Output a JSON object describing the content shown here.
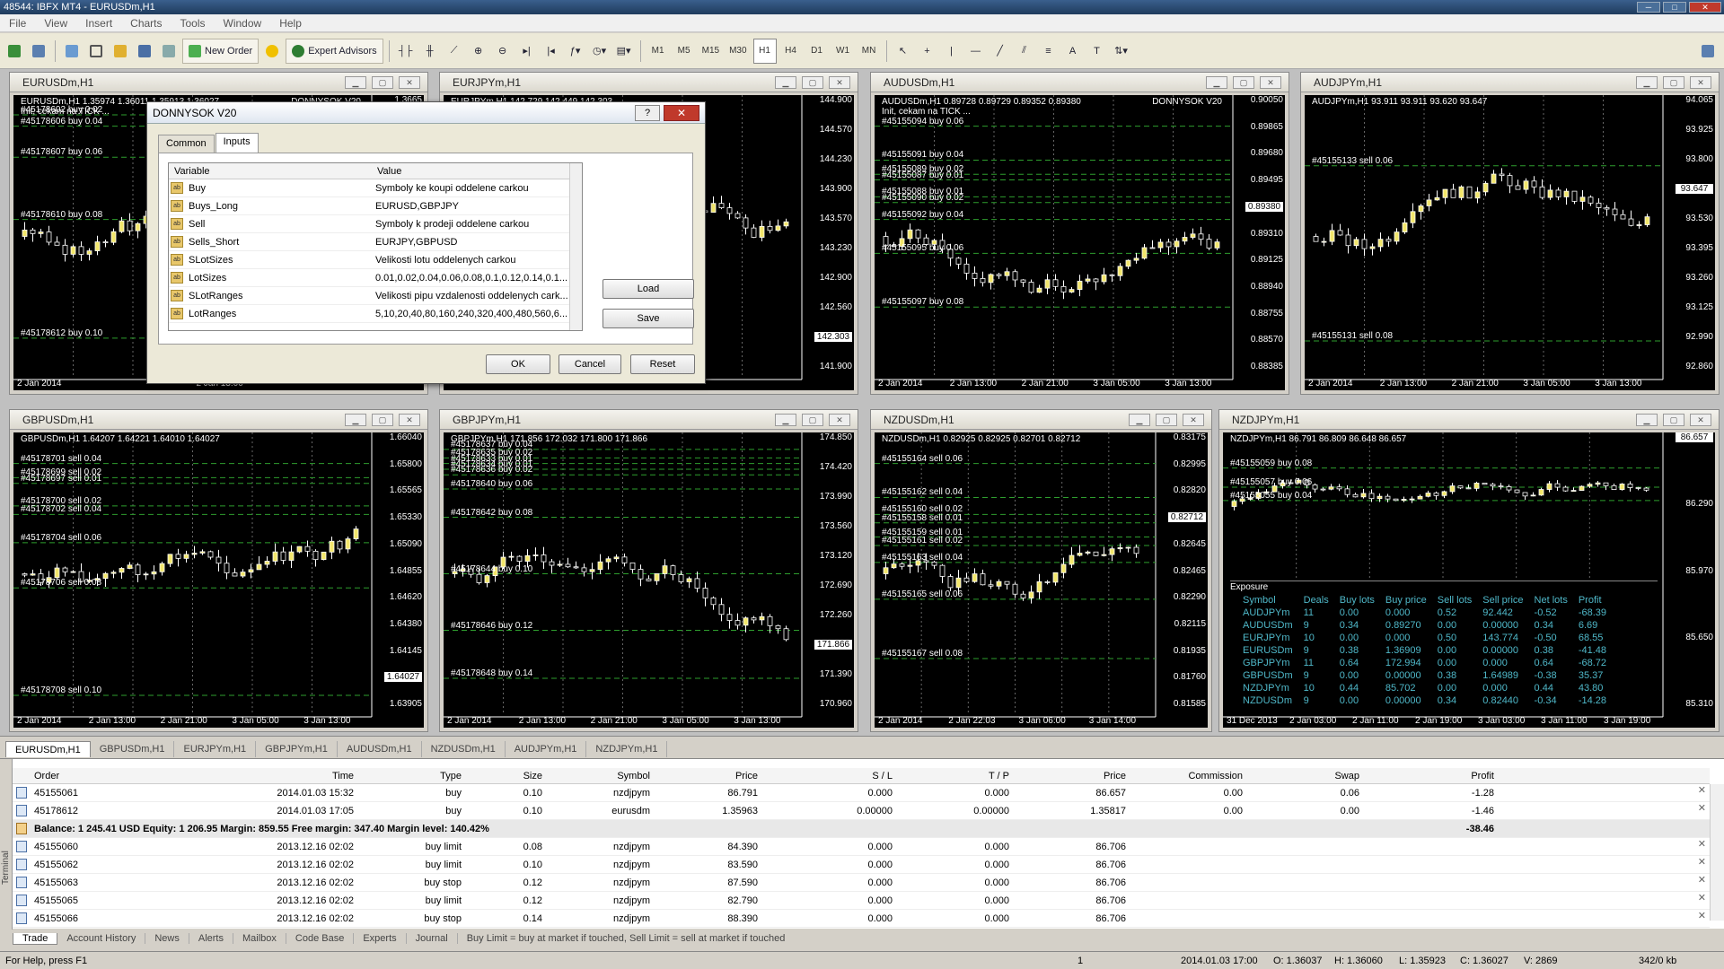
{
  "window": {
    "title": "48544: IBFX MT4 - EURUSDm,H1",
    "min": "─",
    "max": "□",
    "close": "✕"
  },
  "menu": [
    "File",
    "View",
    "Insert",
    "Charts",
    "Tools",
    "Window",
    "Help"
  ],
  "toolbar": {
    "new_order": "New Order",
    "expert_advisors": "Expert Advisors",
    "timeframes": [
      "M1",
      "M5",
      "M15",
      "M30",
      "H1",
      "H4",
      "D1",
      "W1",
      "MN"
    ]
  },
  "charts": [
    {
      "title": "EURUSDm,H1",
      "header": "EURUSDm,H1  1.35974 1.36011 1.35913 1.36027",
      "sub": "Init, cekam na TICK ...",
      "ea": "DONNYSOK V20",
      "prices": [
        "1.3665",
        "1.3640"
      ],
      "times": [
        "2 Jan 2014",
        "2 Jan 13:00"
      ],
      "orders": [
        {
          "t": "#45178602 buy 0.02",
          "y": 0.07
        },
        {
          "t": "#45178606 buy 0.04",
          "y": 0.11
        },
        {
          "t": "#45178607 buy 0.06",
          "y": 0.22
        },
        {
          "t": "#45178610 buy 0.08",
          "y": 0.44
        },
        {
          "t": "#45178612 buy 0.10",
          "y": 0.86
        }
      ]
    },
    {
      "title": "EURJPYm,H1",
      "header": "EURJPYm,H1  142.729 142.449 142.303",
      "sub": "",
      "ea": "",
      "prices": [
        "144.900",
        "144.570",
        "144.230",
        "143.900",
        "143.570",
        "143.230",
        "142.900",
        "142.560",
        "142.303",
        "141.900"
      ],
      "current": "142.303",
      "times": [],
      "orders": []
    },
    {
      "title": "AUDUSDm,H1",
      "header": "AUDUSDm,H1  0.89728 0.89729 0.89352 0.89380",
      "sub": "Init, cekam na TICK ...",
      "ea": "DONNYSOK V20",
      "prices": [
        "0.90050",
        "0.89865",
        "0.89680",
        "0.89495",
        "0.89380",
        "0.89310",
        "0.89125",
        "0.88940",
        "0.88755",
        "0.88570",
        "0.88385"
      ],
      "current": "0.89380",
      "times": [
        "2 Jan 2014",
        "2 Jan 13:00",
        "2 Jan 21:00",
        "3 Jan 05:00",
        "3 Jan 13:00"
      ],
      "orders": [
        {
          "t": "#45155094 buy 0.06",
          "y": 0.11
        },
        {
          "t": "#45155091 buy 0.04",
          "y": 0.23
        },
        {
          "t": "#45155089 buy 0.02",
          "y": 0.28
        },
        {
          "t": "#45155087 buy 0.01",
          "y": 0.3
        },
        {
          "t": "#45155088 buy 0.01",
          "y": 0.36
        },
        {
          "t": "#45155090 buy 0.02",
          "y": 0.38
        },
        {
          "t": "#45155092 buy 0.04",
          "y": 0.44
        },
        {
          "t": "#45155095 buy 0.06",
          "y": 0.56
        },
        {
          "t": "#45155097 buy 0.08",
          "y": 0.75
        }
      ]
    },
    {
      "title": "AUDJPYm,H1",
      "header": "AUDJPYm,H1  93.911 93.911 93.620 93.647",
      "sub": "",
      "ea": "",
      "prices": [
        "94.065",
        "93.925",
        "93.800",
        "93.647",
        "93.530",
        "93.395",
        "93.260",
        "93.125",
        "92.990",
        "92.860"
      ],
      "current": "93.647",
      "times": [
        "2 Jan 2014",
        "2 Jan 13:00",
        "2 Jan 21:00",
        "3 Jan 05:00",
        "3 Jan 13:00"
      ],
      "orders": [
        {
          "t": "#45155133 sell 0.06",
          "y": 0.25
        },
        {
          "t": "#45155131 sell 0.08",
          "y": 0.87
        }
      ]
    },
    {
      "title": "GBPUSDm,H1",
      "header": "GBPUSDm,H1  1.64207 1.64221 1.64010 1.64027",
      "sub": "",
      "ea": "",
      "prices": [
        "1.66040",
        "1.65800",
        "1.65565",
        "1.65330",
        "1.65090",
        "1.64855",
        "1.64620",
        "1.64380",
        "1.64145",
        "1.64027",
        "1.63905"
      ],
      "current": "1.64027",
      "times": [
        "2 Jan 2014",
        "2 Jan 13:00",
        "2 Jan 21:00",
        "3 Jan 05:00",
        "3 Jan 13:00"
      ],
      "orders": [
        {
          "t": "#45178701 sell 0.04",
          "y": 0.11
        },
        {
          "t": "#45178699 sell 0.02",
          "y": 0.16
        },
        {
          "t": "#45178697 sell 0.01",
          "y": 0.18
        },
        {
          "t": "#45178700 sell 0.02",
          "y": 0.26
        },
        {
          "t": "#45178702 sell 0.04",
          "y": 0.29
        },
        {
          "t": "#45178704 sell 0.06",
          "y": 0.39
        },
        {
          "t": "#45178706 sell 0.08",
          "y": 0.55
        },
        {
          "t": "#45178708 sell 0.10",
          "y": 0.93
        }
      ]
    },
    {
      "title": "GBPJPYm,H1",
      "header": "GBPJPYm,H1  171.856 172.032 171.800 171.866",
      "sub": "",
      "ea": "",
      "prices": [
        "174.850",
        "174.420",
        "173.990",
        "173.560",
        "173.120",
        "172.690",
        "172.260",
        "171.866",
        "171.390",
        "170.960"
      ],
      "current": "171.866",
      "times": [
        "2 Jan 2014",
        "2 Jan 13:00",
        "2 Jan 21:00",
        "3 Jan 05:00",
        "3 Jan 13:00"
      ],
      "orders": [
        {
          "t": "#45178637 buy 0.04",
          "y": 0.06
        },
        {
          "t": "#45178635 buy 0.02",
          "y": 0.09
        },
        {
          "t": "#45178633 buy 0.01",
          "y": 0.11
        },
        {
          "t": "#45178634 buy 0.01",
          "y": 0.13
        },
        {
          "t": "#45178636 buy 0.02",
          "y": 0.15
        },
        {
          "t": "#45178640 buy 0.06",
          "y": 0.2
        },
        {
          "t": "#45178642 buy 0.08",
          "y": 0.3
        },
        {
          "t": "#45178644 buy 0.10",
          "y": 0.5
        },
        {
          "t": "#45178646 buy 0.12",
          "y": 0.7
        },
        {
          "t": "#45178648 buy 0.14",
          "y": 0.87
        }
      ]
    },
    {
      "title": "NZDUSDm,H1",
      "header": "NZDUSDm,H1  0.82925 0.82925 0.82701 0.82712",
      "sub": "",
      "ea": "",
      "prices": [
        "0.83175",
        "0.82995",
        "0.82820",
        "0.82712",
        "0.82645",
        "0.82465",
        "0.82290",
        "0.82115",
        "0.81935",
        "0.81760",
        "0.81585"
      ],
      "current": "0.82712",
      "times": [
        "2 Jan 2014",
        "2 Jan 22:03",
        "3 Jan 06:00",
        "3 Jan 14:00"
      ],
      "orders": [
        {
          "t": "#45155164 sell 0.06",
          "y": 0.11
        },
        {
          "t": "#45155162 sell 0.04",
          "y": 0.23
        },
        {
          "t": "#45155160 sell 0.02",
          "y": 0.29
        },
        {
          "t": "#45155158 sell 0.01",
          "y": 0.32
        },
        {
          "t": "#45155159 sell 0.01",
          "y": 0.37
        },
        {
          "t": "#45155161 sell 0.02",
          "y": 0.4
        },
        {
          "t": "#45155163 sell 0.04",
          "y": 0.46
        },
        {
          "t": "#45155165 sell 0.06",
          "y": 0.59
        },
        {
          "t": "#45155167 sell 0.08",
          "y": 0.8
        }
      ]
    },
    {
      "title": "NZDJPYm,H1",
      "header": "NZDJPYm,H1  86.791 86.809 86.648 86.657",
      "sub": "",
      "ea": "",
      "prices": [
        "86.657",
        "86.290",
        "85.970",
        "85.650",
        "85.310"
      ],
      "current": "86.657",
      "times": [
        "31 Dec 2013",
        "2 Jan 03:00",
        "2 Jan 11:00",
        "2 Jan 19:00",
        "3 Jan 03:00",
        "3 Jan 11:00",
        "3 Jan 19:00"
      ],
      "orders": [
        {
          "t": "#45155059 buy 0.08",
          "y": 0.24
        },
        {
          "t": "#45155057 buy 0.06",
          "y": 0.37
        },
        {
          "t": "#45155055 buy 0.04",
          "y": 0.46
        }
      ],
      "exposure": {
        "title": "Exposure",
        "cols": [
          "Symbol",
          "Deals",
          "Buy lots",
          "Buy price",
          "Sell lots",
          "Sell price",
          "Net lots",
          "Profit"
        ],
        "rows": [
          [
            "AUDJPYm",
            "11",
            "0.00",
            "0.000",
            "0.52",
            "92.442",
            "-0.52",
            "-68.39"
          ],
          [
            "AUDUSDm",
            "9",
            "0.34",
            "0.89270",
            "0.00",
            "0.00000",
            "0.34",
            "6.69"
          ],
          [
            "EURJPYm",
            "10",
            "0.00",
            "0.000",
            "0.50",
            "143.774",
            "-0.50",
            "68.55"
          ],
          [
            "EURUSDm",
            "9",
            "0.38",
            "1.36909",
            "0.00",
            "0.00000",
            "0.38",
            "-41.48"
          ],
          [
            "GBPJPYm",
            "11",
            "0.64",
            "172.994",
            "0.00",
            "0.000",
            "0.64",
            "-68.72"
          ],
          [
            "GBPUSDm",
            "9",
            "0.00",
            "0.00000",
            "0.38",
            "1.64989",
            "-0.38",
            "35.37"
          ],
          [
            "NZDJPYm",
            "10",
            "0.44",
            "85.702",
            "0.00",
            "0.000",
            "0.44",
            "43.80"
          ],
          [
            "NZDUSDm",
            "9",
            "0.00",
            "0.00000",
            "0.34",
            "0.82440",
            "-0.34",
            "-14.28"
          ]
        ]
      }
    }
  ],
  "dialog": {
    "title": "DONNYSOK V20",
    "help": "?",
    "close": "✕",
    "tabs": [
      "Common",
      "Inputs"
    ],
    "col_variable": "Variable",
    "col_value": "Value",
    "rows": [
      [
        "Buy",
        "Symboly ke koupi oddelene carkou"
      ],
      [
        "Buys_Long",
        "EURUSD,GBPJPY"
      ],
      [
        "Sell",
        "Symboly k prodeji oddelene carkou"
      ],
      [
        "Sells_Short",
        "EURJPY,GBPUSD"
      ],
      [
        "SLotSizes",
        "Velikosti lotu oddelenych carkou"
      ],
      [
        "LotSizes",
        "0.01,0.02,0.04,0.06,0.08,0.1,0.12,0.14,0.1..."
      ],
      [
        "SLotRanges",
        "Velikosti pipu vzdalenosti oddelenych cark..."
      ],
      [
        "LotRanges",
        "5,10,20,40,80,160,240,320,400,480,560,6..."
      ]
    ],
    "load": "Load",
    "save": "Save",
    "ok": "OK",
    "cancel": "Cancel",
    "reset": "Reset"
  },
  "symbol_tabs": [
    "EURUSDm,H1",
    "GBPUSDm,H1",
    "EURJPYm,H1",
    "GBPJPYm,H1",
    "AUDUSDm,H1",
    "NZDUSDm,H1",
    "AUDJPYm,H1",
    "NZDJPYm,H1"
  ],
  "terminal": {
    "side_label": "Terminal",
    "cols": [
      "Order",
      "Time",
      "Type",
      "Size",
      "Symbol",
      "Price",
      "S / L",
      "T / P",
      "Price",
      "Commission",
      "Swap",
      "Profit"
    ],
    "rows": [
      [
        "45155061",
        "2014.01.03 15:32",
        "buy",
        "0.10",
        "nzdjpym",
        "86.791",
        "0.000",
        "0.000",
        "86.657",
        "0.00",
        "0.06",
        "-1.28"
      ],
      [
        "45178612",
        "2014.01.03 17:05",
        "buy",
        "0.10",
        "eurusdm",
        "1.35963",
        "0.00000",
        "0.00000",
        "1.35817",
        "0.00",
        "0.00",
        "-1.46"
      ]
    ],
    "balance": "Balance: 1 245.41 USD  Equity: 1 206.95  Margin: 859.55  Free margin: 347.40  Margin level: 140.42%",
    "balance_profit": "-38.46",
    "pending": [
      [
        "45155060",
        "2013.12.16 02:02",
        "buy limit",
        "0.08",
        "nzdjpym",
        "84.390",
        "0.000",
        "0.000",
        "86.706"
      ],
      [
        "45155062",
        "2013.12.16 02:02",
        "buy limit",
        "0.10",
        "nzdjpym",
        "83.590",
        "0.000",
        "0.000",
        "86.706"
      ],
      [
        "45155063",
        "2013.12.16 02:02",
        "buy stop",
        "0.12",
        "nzdjpym",
        "87.590",
        "0.000",
        "0.000",
        "86.706"
      ],
      [
        "45155065",
        "2013.12.16 02:02",
        "buy limit",
        "0.12",
        "nzdjpym",
        "82.790",
        "0.000",
        "0.000",
        "86.706"
      ],
      [
        "45155066",
        "2013.12.16 02:02",
        "buy stop",
        "0.14",
        "nzdjpym",
        "88.390",
        "0.000",
        "0.000",
        "86.706"
      ]
    ],
    "tabs": [
      "Trade",
      "Account History",
      "News",
      "Alerts",
      "Mailbox",
      "Code Base",
      "Experts",
      "Journal"
    ],
    "note": "Buy Limit = buy at market if touched, Sell Limit = sell at market if touched"
  },
  "status": {
    "help": "For Help, press F1",
    "profile": "1",
    "time": "2014.01.03 17:00",
    "open": "O: 1.36037",
    "high": "H: 1.36060",
    "low": "L: 1.35923",
    "close": "C: 1.36027",
    "volume": "V: 2869",
    "traffic": "342/0 kb"
  }
}
